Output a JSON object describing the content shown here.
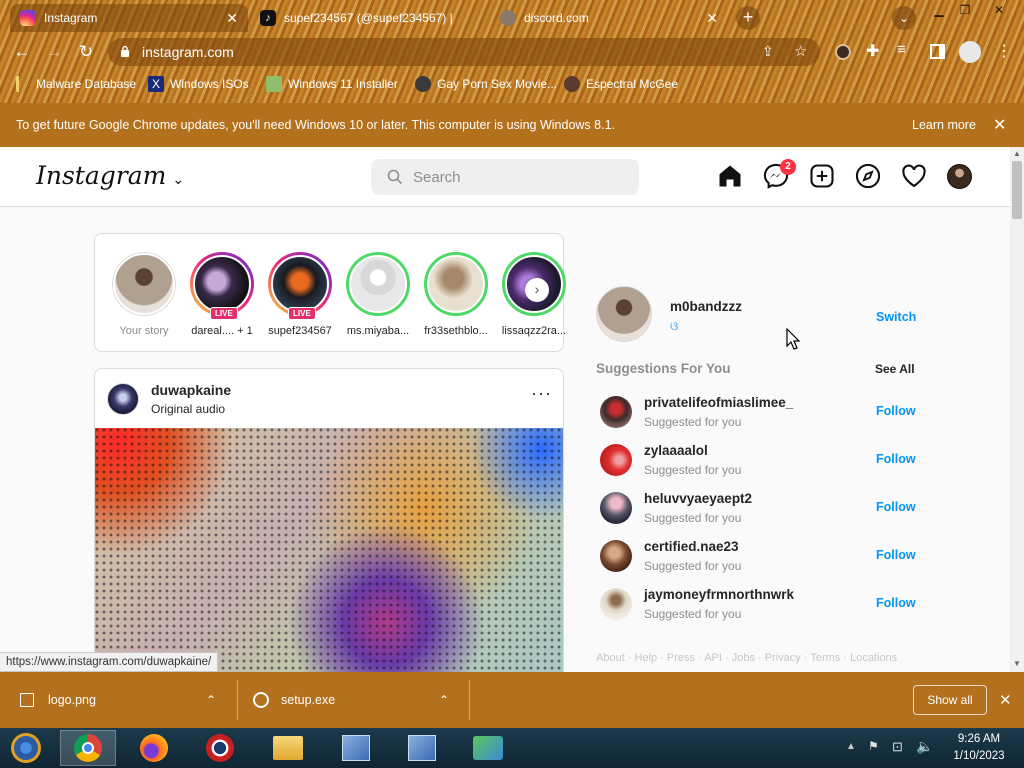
{
  "tabs": [
    {
      "title": "Instagram",
      "active": true
    },
    {
      "title": "supef234567 (@supef234567) |",
      "active": false
    },
    {
      "title": "discord.com",
      "active": false
    }
  ],
  "toolbar": {
    "url": "instagram.com"
  },
  "bookmarks": [
    "Malware Database",
    "Windows ISOs",
    "Windows 11 Installer",
    "Gay Porn Sex Movie...",
    "Espectral McGee"
  ],
  "infobar": {
    "message": "To get future Google Chrome updates, you'll need Windows 10 or later. This computer is using Windows 8.1.",
    "learn_more": "Learn more"
  },
  "instagram": {
    "logo": "Instagram",
    "search_placeholder": "Search",
    "messages_badge": "2",
    "stories": [
      {
        "name": "Your story",
        "live": false
      },
      {
        "name": "dareal.... + 1",
        "live": true
      },
      {
        "name": "supef234567",
        "live": true
      },
      {
        "name": "ms.miyaba...",
        "live": false
      },
      {
        "name": "fr33sethblo...",
        "live": false
      },
      {
        "name": "lissaqzz2ra...",
        "live": false
      }
    ],
    "live_label": "LIVE",
    "post": {
      "username": "duwapkaine",
      "audio": "Original audio"
    },
    "sidebar": {
      "username": "m0bandzzz",
      "switch_label": "Switch",
      "suggestions_title": "Suggestions For You",
      "see_all": "See All",
      "suggestions": [
        {
          "name": "privatelifeofmiaslimee_",
          "sub": "Suggested for you"
        },
        {
          "name": "zylaaaalol",
          "sub": "Suggested for you"
        },
        {
          "name": "heluvvyaeyaept2",
          "sub": "Suggested for you"
        },
        {
          "name": "certified.nae23",
          "sub": "Suggested for you"
        },
        {
          "name": "jaymoneyfrmnorthnwrk",
          "sub": "Suggested for you"
        }
      ],
      "follow_label": "Follow",
      "footer": "About · Help · Press · API · Jobs · Privacy · Terms · Locations"
    }
  },
  "status_url": "https://www.instagram.com/duwapkaine/",
  "downloads": {
    "items": [
      {
        "name": "logo.png"
      },
      {
        "name": "setup.exe"
      }
    ],
    "show_all": "Show all"
  },
  "taskbar": {
    "time": "9:26 AM",
    "date": "1/10/2023"
  },
  "colors": {
    "chrome_brown": "#b3701d",
    "ig_blue": "#0095f6",
    "badge_red": "#ff3040",
    "taskbar": "#0f2533"
  }
}
